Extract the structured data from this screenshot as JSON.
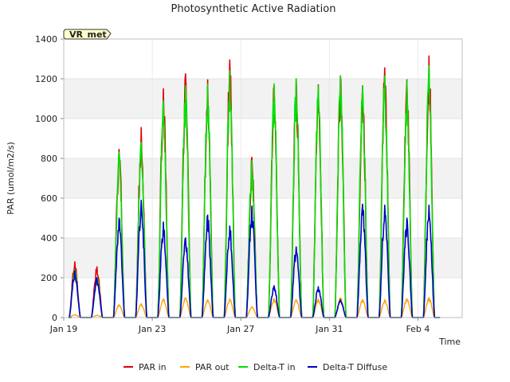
{
  "chart_data": {
    "type": "line",
    "title": "Photosynthetic Active Radiation",
    "xlabel": "Time",
    "ylabel": "PAR (umol/m2/s)",
    "ylim": [
      0,
      1400
    ],
    "yticks": [
      0,
      200,
      400,
      600,
      800,
      1000,
      1200,
      1400
    ],
    "xlim": [
      0,
      18
    ],
    "x_ticks": [
      {
        "x": 0,
        "label": "Jan 19"
      },
      {
        "x": 4,
        "label": "Jan 23"
      },
      {
        "x": 8,
        "label": "Jan 27"
      },
      {
        "x": 12,
        "label": "Jan 31"
      },
      {
        "x": 16,
        "label": "Feb 4"
      }
    ],
    "x_unit": "days since Jan 19",
    "grid": "horizontal bands",
    "legend_position": "bottom",
    "badge": "VR_met",
    "days": [
      0.5,
      1.5,
      2.5,
      3.5,
      4.5,
      5.5,
      6.5,
      7.5,
      8.5,
      9.5,
      10.5,
      11.5,
      12.5,
      13.5,
      14.5,
      15.5,
      16.5
    ],
    "series": [
      {
        "name": "PAR in",
        "color": "#e00000",
        "width": 1.6,
        "peaks": [
          280,
          255,
          845,
          955,
          1150,
          1225,
          1195,
          1295,
          805,
          1165,
          1200,
          1170,
          1215,
          1165,
          1255,
          1195,
          1315
        ]
      },
      {
        "name": "PAR out",
        "color": "#ffa500",
        "width": 1.4,
        "peaks": [
          15,
          12,
          65,
          70,
          95,
          100,
          90,
          95,
          55,
          95,
          90,
          95,
          100,
          90,
          90,
          95,
          100
        ]
      },
      {
        "name": "Delta-T in",
        "color": "#00e000",
        "width": 1.6,
        "peaks": [
          240,
          200,
          830,
          880,
          1090,
          1165,
          1175,
          1240,
          790,
          1175,
          1200,
          1165,
          1215,
          1165,
          1215,
          1190,
          1265
        ]
      },
      {
        "name": "Delta-T Diffuse",
        "color": "#0000cc",
        "width": 1.6,
        "peaks": [
          235,
          200,
          500,
          590,
          480,
          400,
          515,
          460,
          560,
          160,
          355,
          155,
          90,
          570,
          565,
          500,
          565
        ]
      }
    ]
  }
}
